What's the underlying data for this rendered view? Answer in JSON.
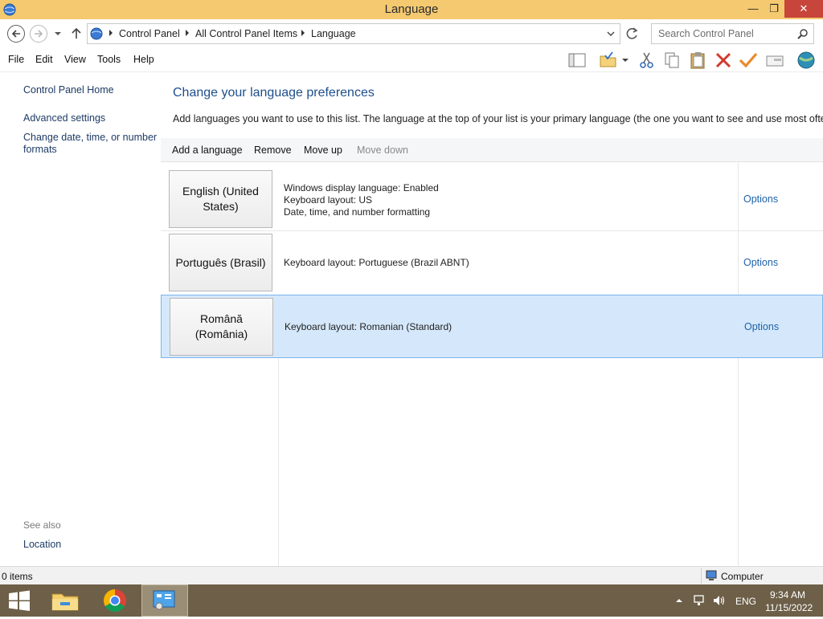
{
  "window": {
    "title": "Language"
  },
  "address": {
    "crumbs": [
      "Control Panel",
      "All Control Panel Items",
      "Language"
    ]
  },
  "search": {
    "placeholder": "Search Control Panel"
  },
  "menu": {
    "file": "File",
    "edit": "Edit",
    "view": "View",
    "tools": "Tools",
    "help": "Help"
  },
  "left_pane": {
    "home": "Control Panel Home",
    "advanced": "Advanced settings",
    "datetime_line1": "Change date, time, or number",
    "datetime_line2": "formats",
    "see_also": "See also",
    "location": "Location"
  },
  "main": {
    "heading": "Change your language preferences",
    "description": "Add languages you want to use to this list. The language at the top of your list is your primary language (the one you want to see and use most often).",
    "commands": {
      "add": "Add a language",
      "remove": "Remove",
      "move_up": "Move up",
      "move_down": "Move down"
    },
    "languages": [
      {
        "name_line1": "English (United",
        "name_line2": "States)",
        "info": [
          "Windows display language: Enabled",
          "Keyboard layout: US",
          "Date, time, and number formatting"
        ],
        "options": "Options"
      },
      {
        "name_line1": "Português (Brasil)",
        "info": [
          "Keyboard layout: Portuguese (Brazil ABNT)"
        ],
        "options": "Options"
      },
      {
        "name_line1": "Română",
        "name_line2": "(România)",
        "info": [
          "Keyboard layout: Romanian (Standard)"
        ],
        "options": "Options",
        "selected": true
      }
    ]
  },
  "status": {
    "items": "0 items",
    "location": "Computer"
  },
  "taskbar": {
    "language": "ENG",
    "time": "9:34 AM",
    "date": "11/15/2022"
  },
  "colors": {
    "title_bar": "#f5c970",
    "link": "#1e62a8",
    "heading": "#1e4e8c",
    "selection": "#d5e8fb",
    "taskbar": "#6d5f48"
  }
}
